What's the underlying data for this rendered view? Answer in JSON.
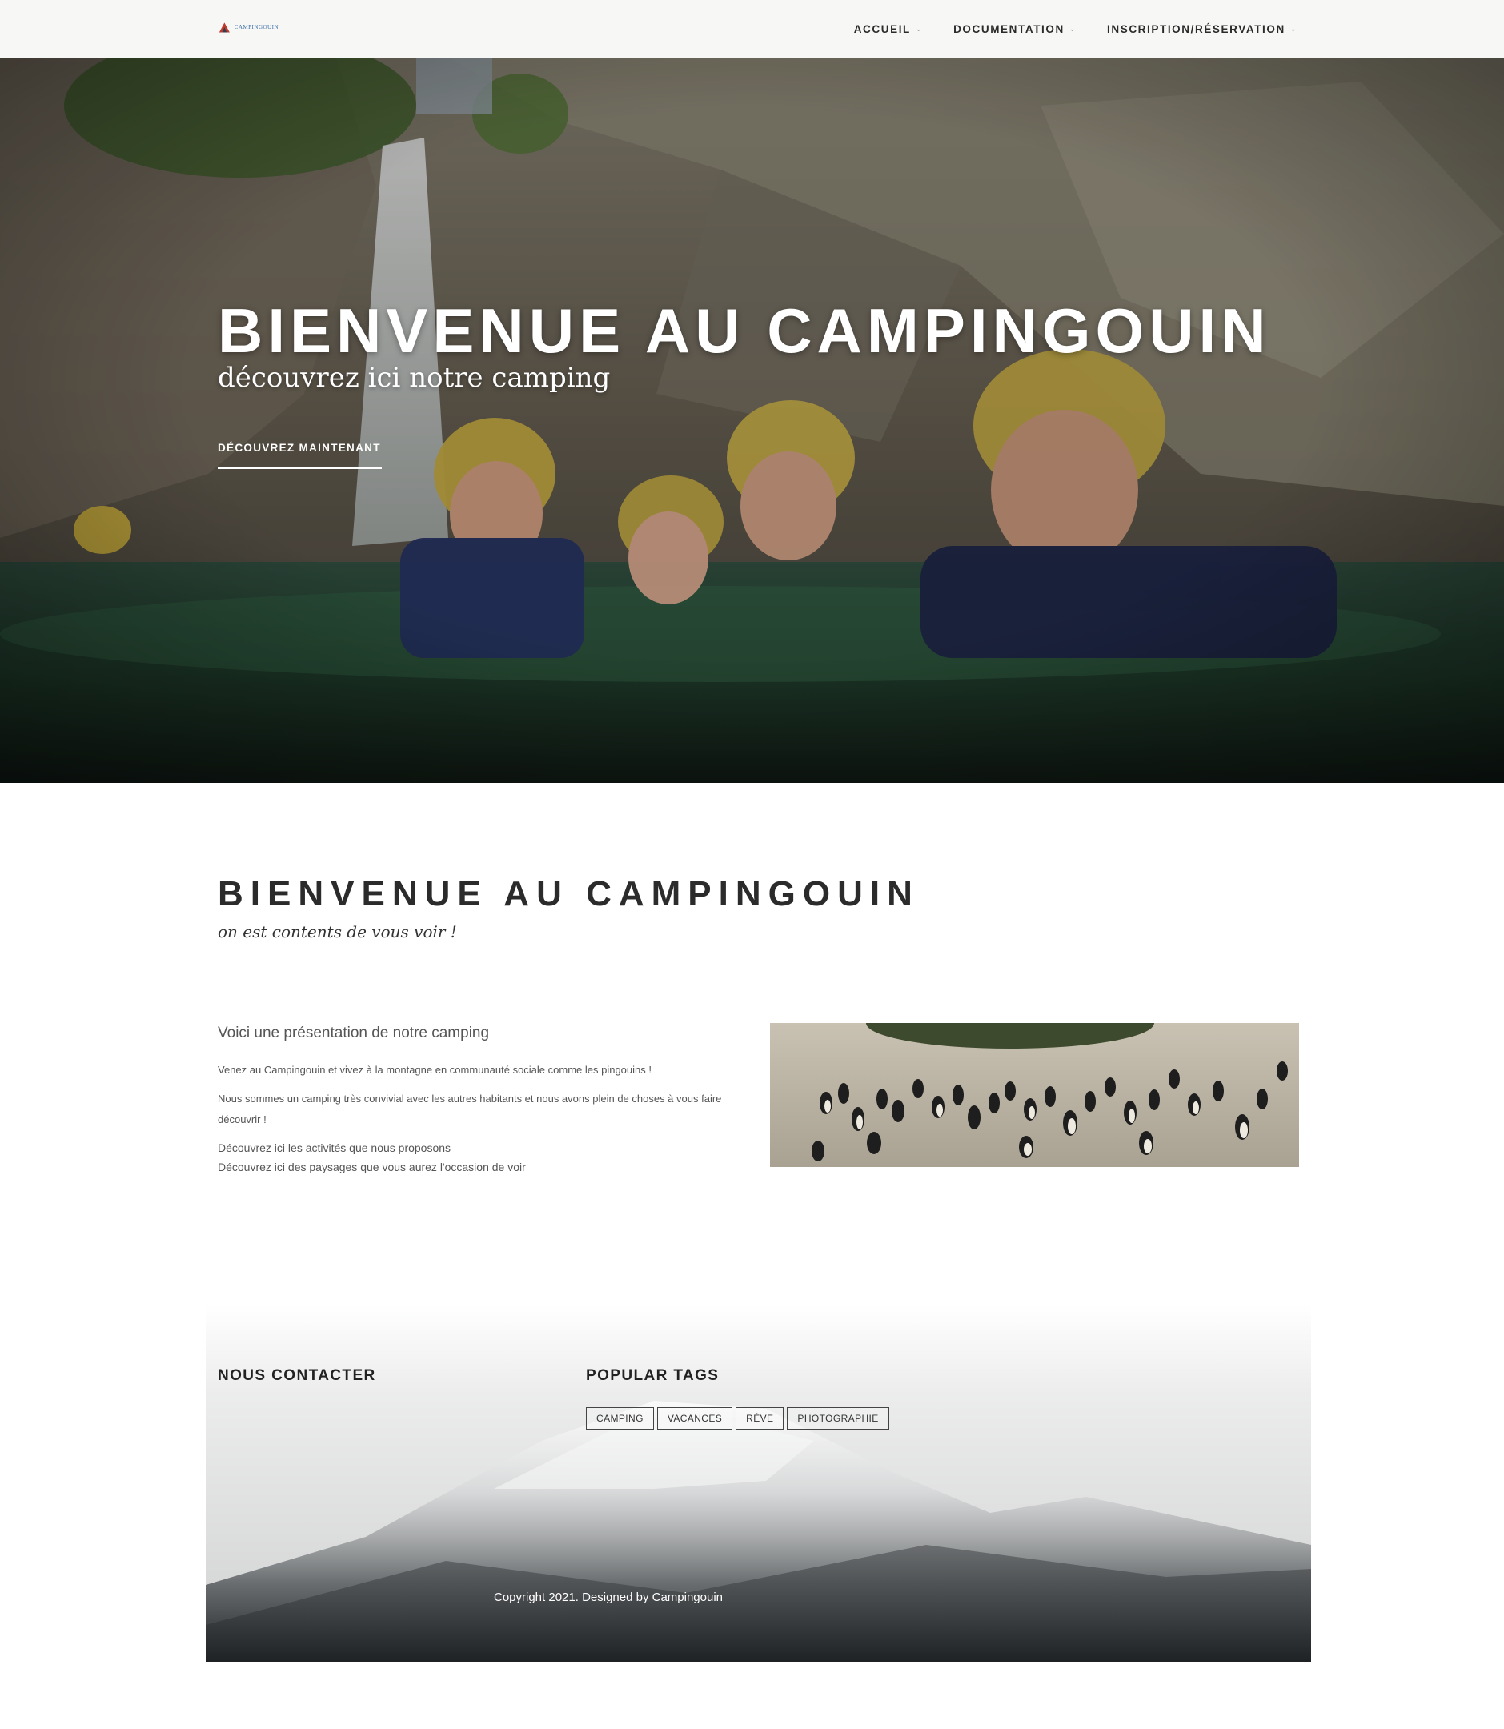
{
  "header": {
    "logo_text": "CAMPINGOUIN",
    "nav": [
      {
        "label": "ACCUEIL"
      },
      {
        "label": "DOCUMENTATION"
      },
      {
        "label": "INSCRIPTION/RÉSERVATION"
      }
    ]
  },
  "hero": {
    "title": "BIENVENUE AU CAMPINGOUIN",
    "subtitle": "découvrez ici notre camping",
    "cta": "DÉCOUVREZ MAINTENANT"
  },
  "welcome": {
    "title": "BIENVENUE AU CAMPINGOUIN",
    "subtitle": "on est contents de vous voir !"
  },
  "presentation": {
    "heading": "Voici une présentation de notre camping",
    "paragraphs": [
      "Venez au Campingouin et vivez à la montagne en communauté sociale comme les pingouins !",
      "Nous sommes un camping très convivial avec les autres habitants et nous avons plein de choses à vous faire découvrir !"
    ],
    "links": [
      "Découvrez ici les activités que nous proposons",
      "Découvrez ici des paysages que vous aurez l'occasion de voir"
    ]
  },
  "footer": {
    "contact_heading": "NOUS CONTACTER",
    "tags_heading": "POPULAR TAGS",
    "tags": [
      "CAMPING",
      "VACANCES",
      "RÊVE",
      "PHOTOGRAPHIE"
    ],
    "copyright": "Copyright 2021. Designed by Campingouin"
  },
  "colors": {
    "header_bg": "#f7f7f6",
    "text_dark": "#2b2b2b",
    "hero_text": "#ffffff"
  },
  "icons": [
    "logo-icon",
    "chevron-down-icon"
  ]
}
